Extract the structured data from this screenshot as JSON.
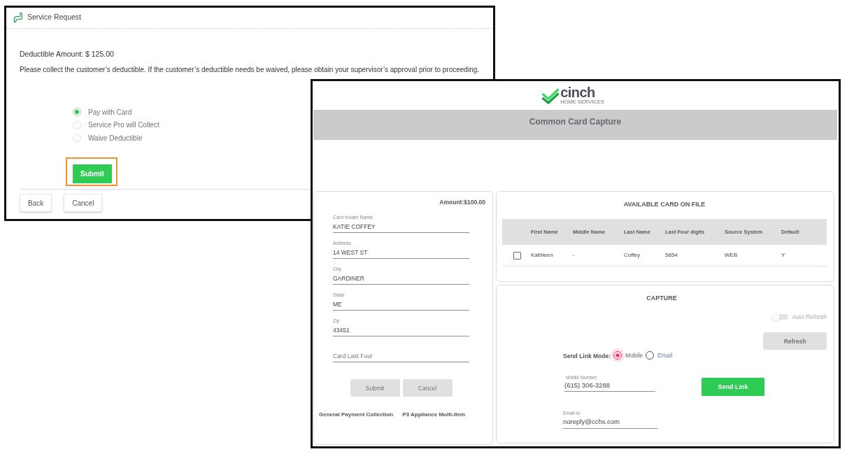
{
  "service_request": {
    "title": "Service Request",
    "deductible": "Deductible Amount: $ 125.00",
    "message": "Please collect the customer’s deductible. If the customer’s deductible needs be waived, please obtain your supervisor’s approval prior to proceeding.",
    "payment_options": [
      {
        "label": "Pay with Card",
        "selected": true
      },
      {
        "label": "Service Pro will Collect",
        "selected": false
      },
      {
        "label": "Waive Deductible",
        "selected": false
      }
    ],
    "submit_button": {
      "label": "Submit",
      "highlighted": true
    },
    "buttons": [
      "Back",
      "Cancel"
    ]
  },
  "card_capture": {
    "logo": {
      "wordmark": "cinch",
      "tagline": "HOME SERVICES"
    },
    "title": "Common Card Capture",
    "payment_form": {
      "amount": "Amount:$100.00",
      "fields": [
        {
          "label": "Card holder Name",
          "value": "KATIE COFFEY"
        },
        {
          "label": "Address",
          "value": "14 WEST ST"
        },
        {
          "label": "City",
          "value": "GARDINER"
        },
        {
          "label": "State",
          "value": "ME"
        },
        {
          "label": "Zip",
          "value": "43451"
        },
        {
          "placeholder": "Card Last Four"
        }
      ],
      "buttons": [
        {
          "label": "Submit",
          "disabled": true
        },
        {
          "label": "Cancel",
          "disabled": true
        }
      ],
      "links": [
        "General Payment Collection",
        "P3 Appliance Multi-Item"
      ]
    },
    "cards_on_file": {
      "title": "AVAILABLE CARD ON FILE",
      "columns": [
        "First Name",
        "Middle Name",
        "Last Name",
        "Last Four digits",
        "Source System",
        "Default"
      ],
      "rows": [
        {
          "checked": false,
          "cells": [
            "Kathleen",
            "-",
            "Coffey",
            "5854",
            "WEB",
            "Y"
          ]
        }
      ]
    },
    "capture": {
      "title": "CAPTURE",
      "auto_refresh": {
        "label": "Auto Refresh",
        "on": false,
        "disabled": true
      },
      "refresh_button": {
        "label": "Refresh",
        "disabled": true
      },
      "send_link_mode": {
        "label": "Send Link Mode:",
        "options": [
          {
            "label": "Mobile",
            "selected": true
          },
          {
            "label": "Email",
            "selected": false
          }
        ]
      },
      "mobile_number": {
        "label": "Mobile Number:",
        "value": "(615) 306-3288"
      },
      "send_link_button": {
        "label": "Send Link"
      },
      "email": {
        "label": "Email Id:",
        "value": "noreply@cchs.com"
      }
    }
  }
}
